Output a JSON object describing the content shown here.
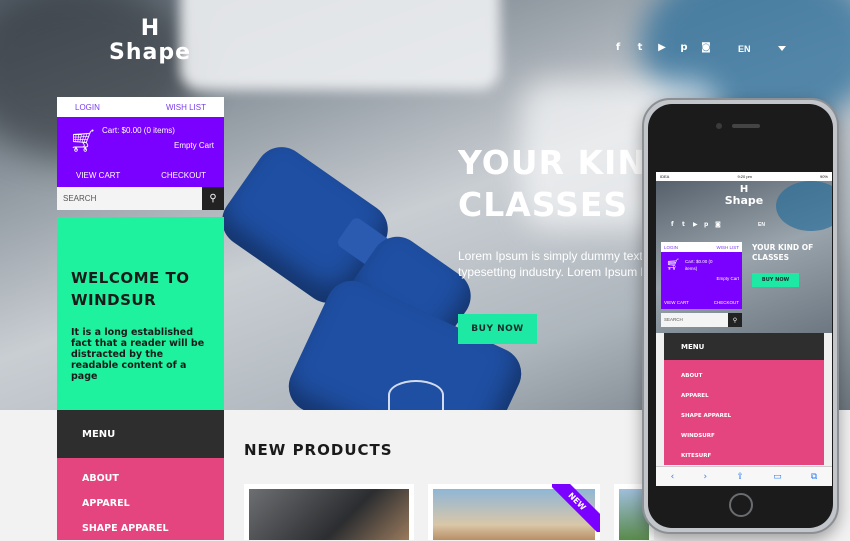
{
  "brand": {
    "logo_mark": "H",
    "logo_text": "Shape"
  },
  "social": {
    "icons": [
      "f",
      "t",
      "yt",
      "p",
      "ig"
    ]
  },
  "language": {
    "current": "EN"
  },
  "hero": {
    "title_line1": "YOUR KIND OF",
    "title_line2": "CLASSES",
    "description_line1": "Lorem Ipsum is simply dummy text of the printing and",
    "description_line2": "typesetting industry. Lorem Ipsum has been the",
    "buy_label": "BUY NOW"
  },
  "account": {
    "login": "LOGIN",
    "wishlist": "WISH LIST"
  },
  "cart": {
    "summary": "Cart: $0.00 (0 items)",
    "empty": "Empty Cart",
    "view_cart": "VIEW CART",
    "checkout": "CHECKOUT"
  },
  "search": {
    "placeholder": "SEARCH"
  },
  "welcome": {
    "title": "WELCOME TO WINDSUR",
    "text": "It is a long established fact that a reader will be distracted by the readable content of a page"
  },
  "menu": {
    "heading": "MENU",
    "items": [
      "ABOUT",
      "APPAREL",
      "SHAPE APPAREL",
      "WINDSURF",
      "KITESURF"
    ]
  },
  "products": {
    "heading": "NEW PRODUCTS",
    "badge": "NEW"
  },
  "phone": {
    "carrier": "IDEA",
    "time": "9:20 pm",
    "battery": "90%",
    "cart_summary": "Cart: $0.00 (0 items)",
    "hero_title": "YOUR KIND OF CLASSES"
  },
  "colors": {
    "accent_green": "#1de9a4",
    "purple": "#7a00ff",
    "pink": "#e5457f",
    "dark": "#2e2e2e"
  }
}
